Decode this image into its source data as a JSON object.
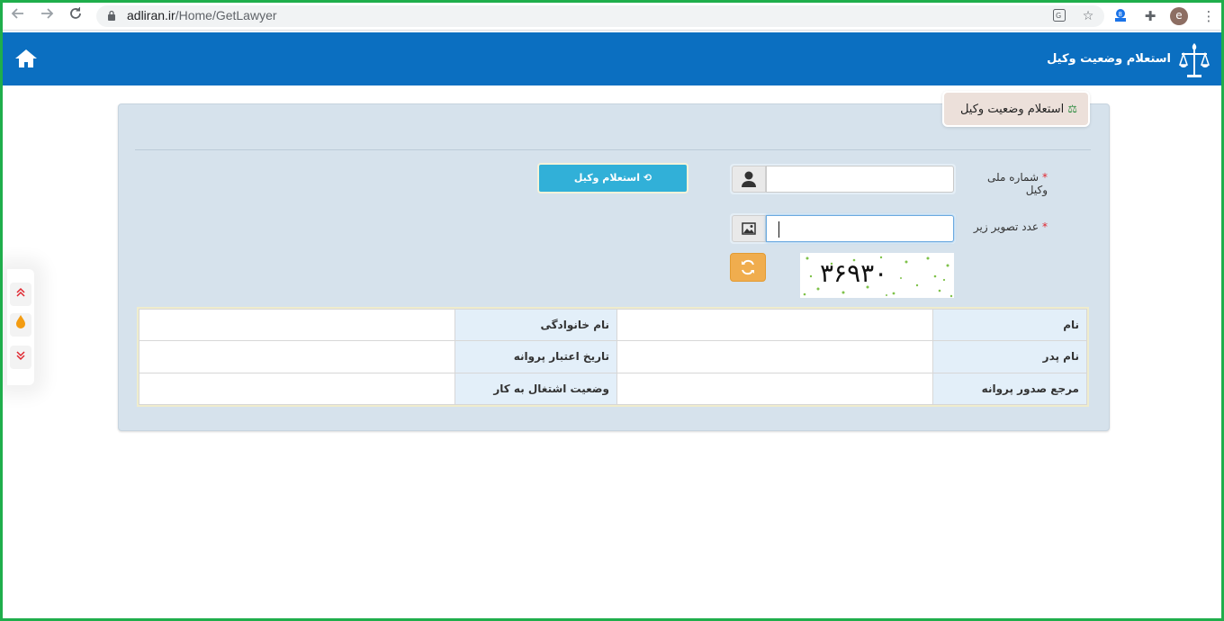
{
  "browser": {
    "url_domain": "adliran.ir",
    "url_path": "/Home/GetLawyer",
    "avatar_letter": "e",
    "icons": [
      "back-arrow-icon",
      "forward-arrow-icon",
      "reload-icon",
      "lock-icon",
      "translate-icon",
      "star-icon",
      "extension-icon",
      "puzzle-icon",
      "menu-icon"
    ]
  },
  "header": {
    "title": "استعلام وضعیت وکیل",
    "background": "#0b6fc1"
  },
  "panel": {
    "tab_title": "استعلام وضعیت وکیل"
  },
  "form": {
    "national_id_label": "شماره ملی وکیل",
    "national_id_value": "",
    "captcha_label": "عدد تصویر زیر",
    "captcha_value": "",
    "required_mark": "*",
    "inquiry_button": "استعلام وکیل",
    "captcha_image_text": "۳۶۹۳۰"
  },
  "result": {
    "rows": [
      {
        "label_a": "نام",
        "value_a": "",
        "label_b": "نام خانوادگی",
        "value_b": ""
      },
      {
        "label_a": "نام پدر",
        "value_a": "",
        "label_b": "تاریخ اعتبار پروانه",
        "value_b": ""
      },
      {
        "label_a": "مرجع صدور پروانه",
        "value_a": "",
        "label_b": "وضعیت اشتغال به کار",
        "value_b": ""
      }
    ]
  },
  "colors": {
    "accent": "#31b0d8",
    "warning": "#f0ad4e",
    "frame": "#1fae4b",
    "required": "#e0262f"
  }
}
